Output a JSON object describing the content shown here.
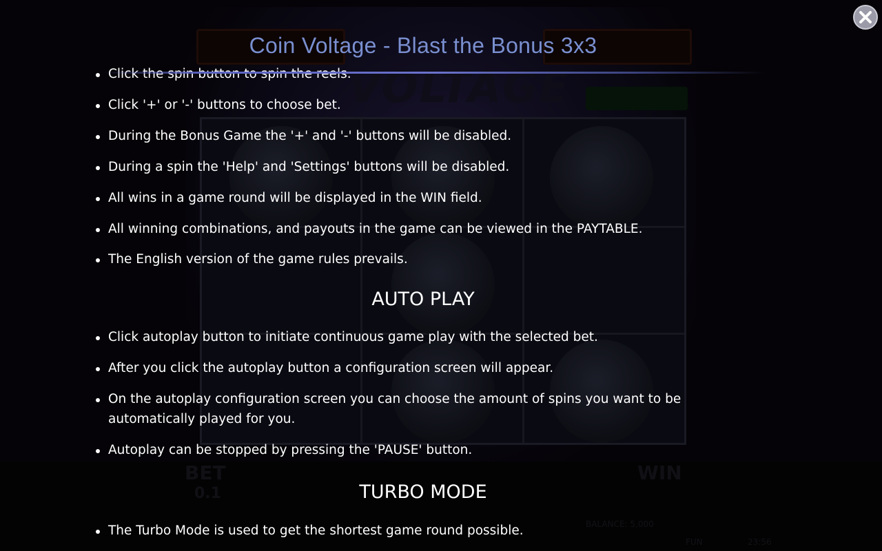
{
  "dialog": {
    "title": "Coin Voltage - Blast the Bonus 3x3",
    "close_icon": "close-icon"
  },
  "general_rules": [
    "Click the spin button to spin the reels.",
    "Click '+' or '-' buttons to choose bet.",
    "During the Bonus Game the '+' and '-' buttons will be disabled.",
    "During a spin the 'Help' and 'Settings' buttons will be disabled.",
    "All wins in a game round will be displayed in the WIN field.",
    "All winning combinations, and payouts in the game can be viewed in the PAYTABLE.",
    "The English version of the game rules prevails."
  ],
  "auto_play": {
    "heading": "AUTO PLAY",
    "items": [
      "Click autoplay button to initiate continuous game play with the selected bet.",
      "After you click the autoplay button a configuration screen will appear.",
      "On the autoplay configuration screen you can choose the amount of spins you want to be automatically played for you.",
      "Autoplay can be stopped by pressing the 'PAUSE' button."
    ]
  },
  "turbo_mode": {
    "heading": "TURBO MODE",
    "items": [
      "The Turbo Mode is used to get the shortest game round possible."
    ]
  },
  "background_game": {
    "bet_label": "BET",
    "bet_value": "0.1",
    "win_label": "WIN",
    "balance_text": "BALANCE: 5,000",
    "fun_label": "FUN",
    "clock": "23:56"
  },
  "colors": {
    "title": "#7a8fd0",
    "accent_rule": "#5a63c0",
    "text": "#ffffff"
  }
}
